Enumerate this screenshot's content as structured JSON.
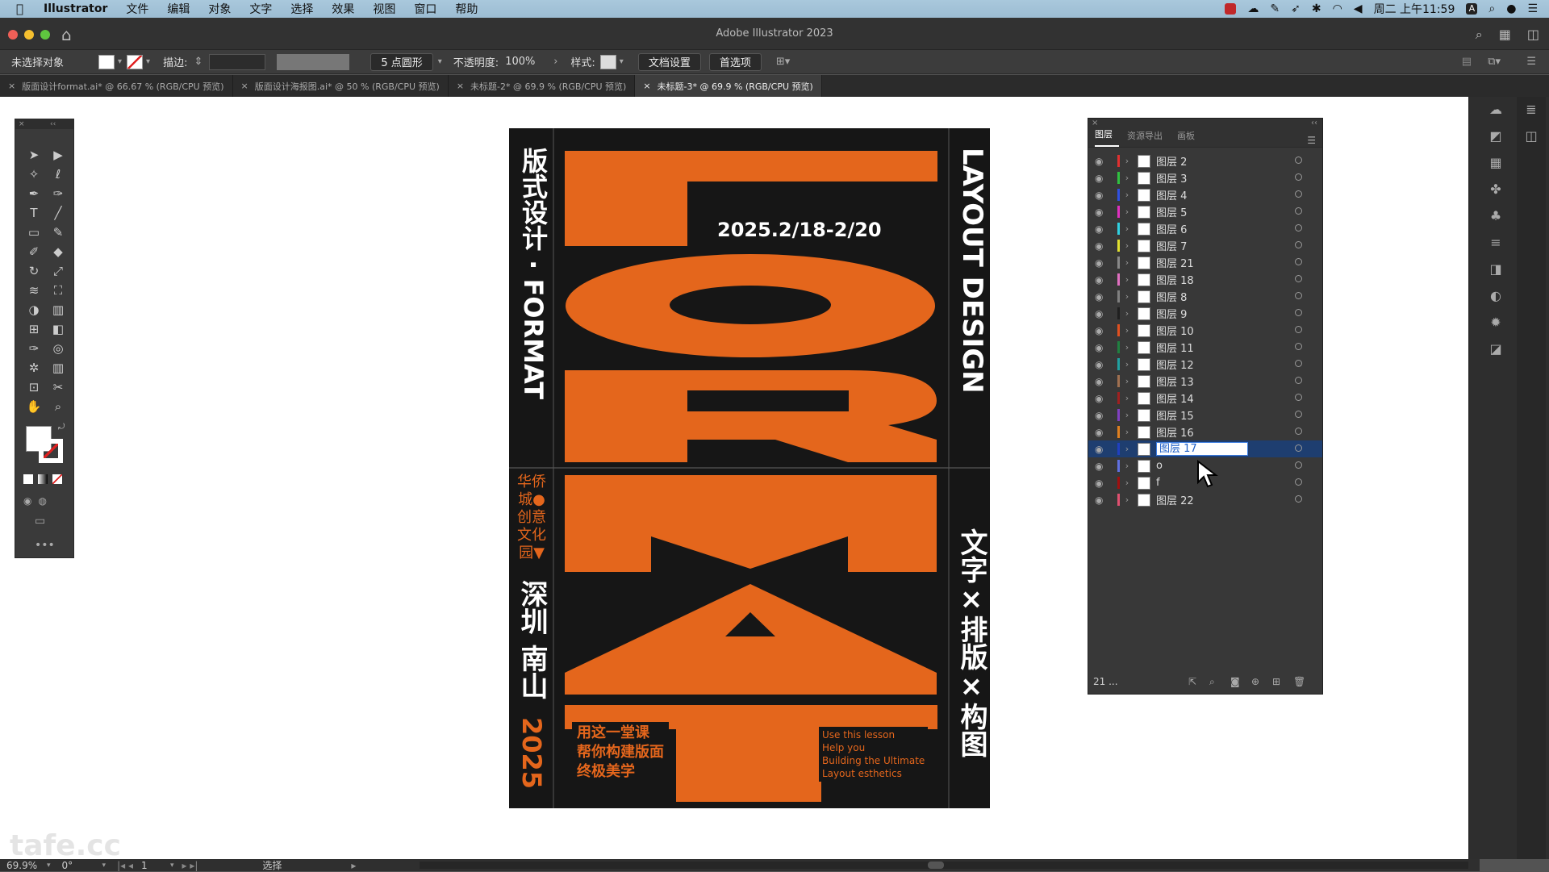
{
  "menubar": {
    "app": "Illustrator",
    "items": [
      "文件",
      "编辑",
      "对象",
      "文字",
      "选择",
      "效果",
      "视图",
      "窗口",
      "帮助"
    ],
    "clock": "周二 上午11:59"
  },
  "window": {
    "title": "Adobe Illustrator 2023"
  },
  "control": {
    "selection": "未选择对象",
    "stroke_label": "描边:",
    "brush": "5 点圆形",
    "opacity_label": "不透明度:",
    "opacity_value": "100%",
    "style_label": "样式:",
    "doc_setup": "文档设置",
    "prefs": "首选项"
  },
  "tabs": [
    {
      "label": "版面设计format.ai* @ 66.67 % (RGB/CPU 预览)",
      "active": false
    },
    {
      "label": "版面设计海报图.ai* @ 50 % (RGB/CPU 预览)",
      "active": false
    },
    {
      "label": "未标题-2* @ 69.9 % (RGB/CPU 预览)",
      "active": false
    },
    {
      "label": "未标题-3* @ 69.9 % (RGB/CPU 预览)",
      "active": true
    }
  ],
  "poster": {
    "title_left": "版式设计 · FORMAT",
    "date": "2025.2/18-2/20",
    "title_right": "LAYOUT DESIGN",
    "venue": [
      "华侨",
      "城●",
      "创意",
      "文化",
      "园▼"
    ],
    "city": "深圳 南山",
    "year": "2025",
    "right_words": "文字×排版×构图",
    "cn_lines": [
      "用这一堂课",
      "帮你构建版面",
      "终极美学"
    ],
    "en_lines": [
      "Use this lesson",
      "Help you",
      "Building the Ultimate",
      "Layout esthetics"
    ],
    "accent": "#e4661c"
  },
  "layers_panel": {
    "tabs": [
      "图层",
      "资源导出",
      "画板"
    ],
    "layers": [
      {
        "name": "图层 2",
        "color": "#e03030"
      },
      {
        "name": "图层 3",
        "color": "#30c040"
      },
      {
        "name": "图层 4",
        "color": "#3050e0"
      },
      {
        "name": "图层 5",
        "color": "#e030c0"
      },
      {
        "name": "图层 6",
        "color": "#30d0e0"
      },
      {
        "name": "图层 7",
        "color": "#e0e030"
      },
      {
        "name": "图层 21",
        "color": "#888888"
      },
      {
        "name": "图层 18",
        "color": "#e070c0"
      },
      {
        "name": "图层 8",
        "color": "#808080"
      },
      {
        "name": "图层 9",
        "color": "#202020"
      },
      {
        "name": "图层 10",
        "color": "#e05020"
      },
      {
        "name": "图层 11",
        "color": "#208040"
      },
      {
        "name": "图层 12",
        "color": "#20a0a0"
      },
      {
        "name": "图层 13",
        "color": "#a07050"
      },
      {
        "name": "图层 14",
        "color": "#a02020"
      },
      {
        "name": "图层 15",
        "color": "#8040c0"
      },
      {
        "name": "图层 16",
        "color": "#e08020"
      },
      {
        "name": "图层 17",
        "color": "#2040c0",
        "selected": true
      },
      {
        "name": "o",
        "color": "#6070e0"
      },
      {
        "name": "f",
        "color": "#a01010"
      },
      {
        "name": "图层 22",
        "color": "#e05070"
      }
    ],
    "count": "21 ..."
  },
  "status": {
    "zoom": "69.9%",
    "rotation": "0°",
    "artboard": "1",
    "tool": "选择"
  },
  "watermark": "tafe.cc"
}
